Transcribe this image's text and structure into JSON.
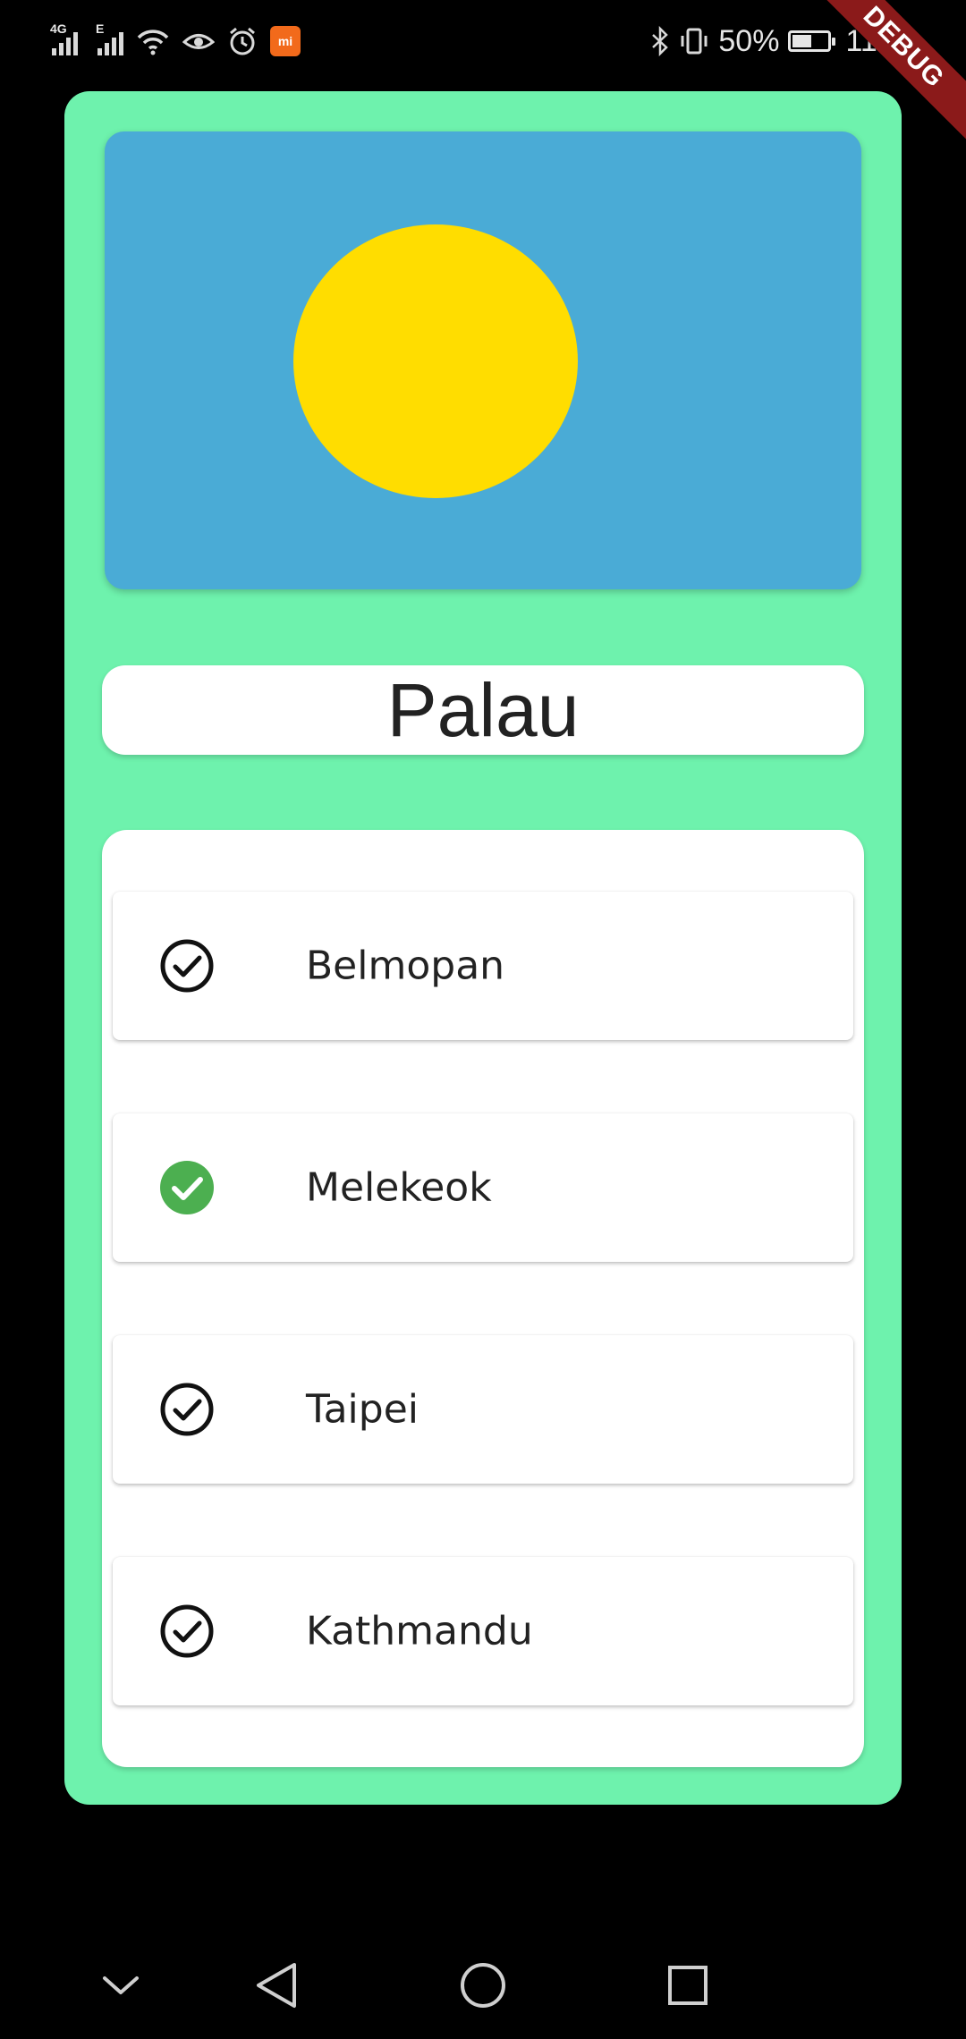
{
  "status_bar": {
    "signal1_tech": "4G",
    "signal2_tech": "E",
    "battery_percent": "50%",
    "time": "11:18",
    "battery_level": 0.5
  },
  "debug_banner": "DEBUG",
  "quiz": {
    "country": "Palau",
    "flag": {
      "background_color": "#4aabd6",
      "disc_color": "#ffdd00"
    },
    "options": [
      {
        "label": "Belmopan",
        "state": "unselected"
      },
      {
        "label": "Melekeok",
        "state": "correct"
      },
      {
        "label": "Taipei",
        "state": "unselected"
      },
      {
        "label": "Kathmandu",
        "state": "unselected"
      }
    ],
    "correct_color": "#4caf50",
    "card_color": "#6ef2ad"
  },
  "navigation": {
    "buttons": [
      "collapse-icon",
      "back-icon",
      "home-icon",
      "recents-icon"
    ]
  }
}
